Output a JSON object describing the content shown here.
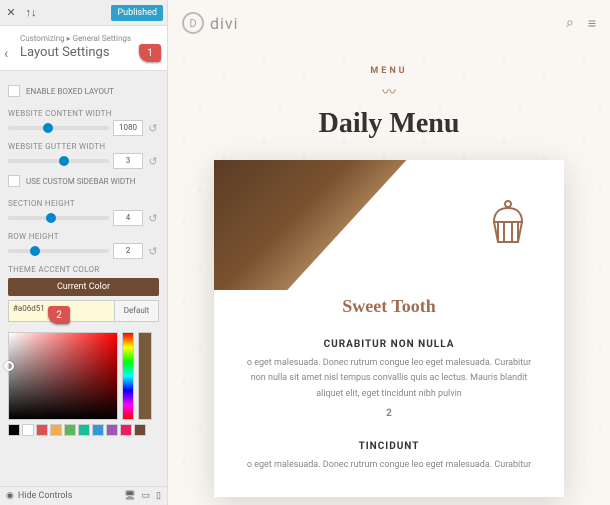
{
  "topbar": {
    "publish": "Published"
  },
  "header": {
    "breadcrumb": "Customizing ▸ General Settings",
    "title": "Layout Settings"
  },
  "controls": {
    "boxed": "ENABLE BOXED LAYOUT",
    "content_width": {
      "label": "WEBSITE CONTENT WIDTH",
      "value": "1080"
    },
    "gutter_width": {
      "label": "WEBSITE GUTTER WIDTH",
      "value": "3"
    },
    "custom_sidebar": "USE CUSTOM SIDEBAR WIDTH",
    "section_h": {
      "label": "SECTION HEIGHT",
      "value": "4"
    },
    "row_h": {
      "label": "ROW HEIGHT",
      "value": "2"
    },
    "accent": {
      "label": "THEME ACCENT COLOR",
      "current": "Current Color",
      "hex": "#a06d51",
      "default": "Default"
    }
  },
  "swatches": [
    "#000000",
    "#ffffff",
    "#d9534f",
    "#f0ad4e",
    "#5cb85c",
    "#1abc9c",
    "#3498db",
    "#9b59b6",
    "#e91e63",
    "#6d4a31"
  ],
  "footer": {
    "hide": "Hide Controls"
  },
  "preview": {
    "brand": "divi",
    "tag": "MENU",
    "title": "Daily Menu",
    "card": {
      "heading": "Sweet Tooth",
      "item1": {
        "title": "CURABITUR NON NULLA",
        "body": "o eget malesuada. Donec rutrum congue leo eget malesuada. Curabitur non nulla sit amet nisl tempus convallis quis ac lectus. Mauris blandit aliquet elit, eget tincidunt nibh pulvin",
        "price": "2"
      },
      "item2": {
        "title": "TINCIDUNT",
        "body": "o eget malesuada. Donec rutrum congue leo eget malesuada. Curabitur"
      }
    }
  },
  "markers": {
    "one": "1",
    "two": "2"
  }
}
